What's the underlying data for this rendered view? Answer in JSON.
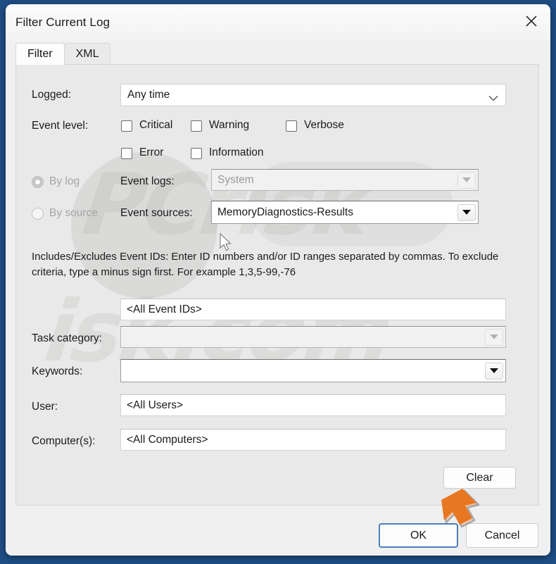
{
  "window": {
    "title": "Filter Current Log",
    "close_icon": "close-icon"
  },
  "tabs": [
    {
      "label": "Filter",
      "active": true
    },
    {
      "label": "XML",
      "active": false
    }
  ],
  "form": {
    "logged": {
      "label": "Logged:",
      "value": "Any time",
      "chevron_icon": "chevron-down-icon"
    },
    "event_level": {
      "label": "Event level:",
      "options": [
        {
          "label": "Critical",
          "checked": false
        },
        {
          "label": "Warning",
          "checked": false
        },
        {
          "label": "Verbose",
          "checked": false
        },
        {
          "label": "Error",
          "checked": false
        },
        {
          "label": "Information",
          "checked": false
        }
      ]
    },
    "source_mode": {
      "by_log": {
        "label": "By log",
        "selected": true,
        "disabled": true
      },
      "by_source": {
        "label": "By source",
        "selected": false,
        "disabled": true
      }
    },
    "event_logs": {
      "label": "Event logs:",
      "value": "System",
      "disabled": true,
      "dropdown_icon": "dropdown-arrow-icon"
    },
    "event_sources": {
      "label": "Event sources:",
      "value": "MemoryDiagnostics-Results",
      "disabled": false,
      "dropdown_icon": "dropdown-arrow-icon"
    },
    "event_ids_help": "Includes/Excludes Event IDs: Enter ID numbers and/or ID ranges separated by commas. To exclude criteria, type a minus sign first. For example 1,3,5-99,-76",
    "event_ids": {
      "value": "<All Event IDs>"
    },
    "task_category": {
      "label": "Task category:",
      "value": "",
      "disabled": true,
      "dropdown_icon": "dropdown-arrow-icon"
    },
    "keywords": {
      "label": "Keywords:",
      "value": "",
      "disabled": false,
      "dropdown_icon": "dropdown-arrow-icon"
    },
    "user": {
      "label": "User:",
      "value": "<All Users>"
    },
    "computers": {
      "label": "Computer(s):",
      "value": "<All Computers>"
    },
    "clear_button": "Clear"
  },
  "footer": {
    "ok_label": "OK",
    "cancel_label": "Cancel"
  },
  "annotation": {
    "arrow_color": "#e87722",
    "arrow_target": "OK"
  },
  "watermark": {
    "line1": "PCrisk",
    "line2": "isk.com"
  },
  "colors": {
    "desktop": "#1f4e85",
    "dialog_bg": "#f0f0f0",
    "panel_bg": "#e9e9e9",
    "focus_border": "#4a7fbd",
    "accent_orange": "#e87722"
  }
}
